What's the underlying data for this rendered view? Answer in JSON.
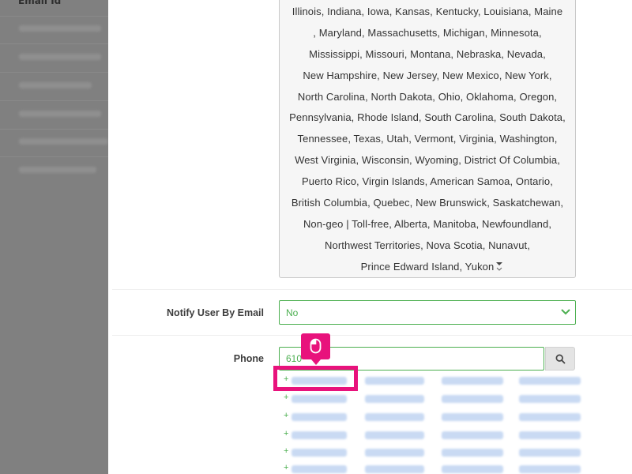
{
  "background_page": {
    "column_header": "Email Id"
  },
  "states_list": {
    "lines": [
      "Illinois,  Indiana,  Iowa,  Kansas,  Kentucky,  Louisiana,  Maine",
      ",  Maryland,  Massachusetts,  Michigan,  Minnesota,",
      "Mississippi,  Missouri,  Montana,  Nebraska,  Nevada,",
      "New Hampshire,  New Jersey,  New Mexico,  New York,",
      "North Carolina,  North Dakota,  Ohio,  Oklahoma,  Oregon,",
      "Pennsylvania,  Rhode Island,  South Carolina,  South Dakota,",
      "Tennessee,  Texas,  Utah,  Vermont,  Virginia,  Washington,",
      "West Virginia,  Wisconsin,  Wyoming,  District Of Columbia,",
      "Puerto Rico,  Virgin Islands,  American Samoa,  Ontario,",
      "British Columbia,  Quebec,  New Brunswick,  Saskatchewan,",
      "Non-geo | Toll-free,  Alberta,  Manitoba,  Newfoundland,",
      "Northwest Territories,  Nova Scotia,  Nunavut,",
      "Prince Edward Island,  Yukon"
    ]
  },
  "notify_field": {
    "label": "Notify User By Email",
    "value": "No"
  },
  "phone_field": {
    "label": "Phone",
    "value": "610",
    "suggestion_prefix": "+"
  },
  "icons": {
    "search": "search-icon",
    "caret": "chevron-down-icon",
    "cursor": "mouse-icon"
  },
  "colors": {
    "accent_green": "#4caf50",
    "highlight_pink": "#e8127c",
    "overlay_gray": "#808080"
  }
}
